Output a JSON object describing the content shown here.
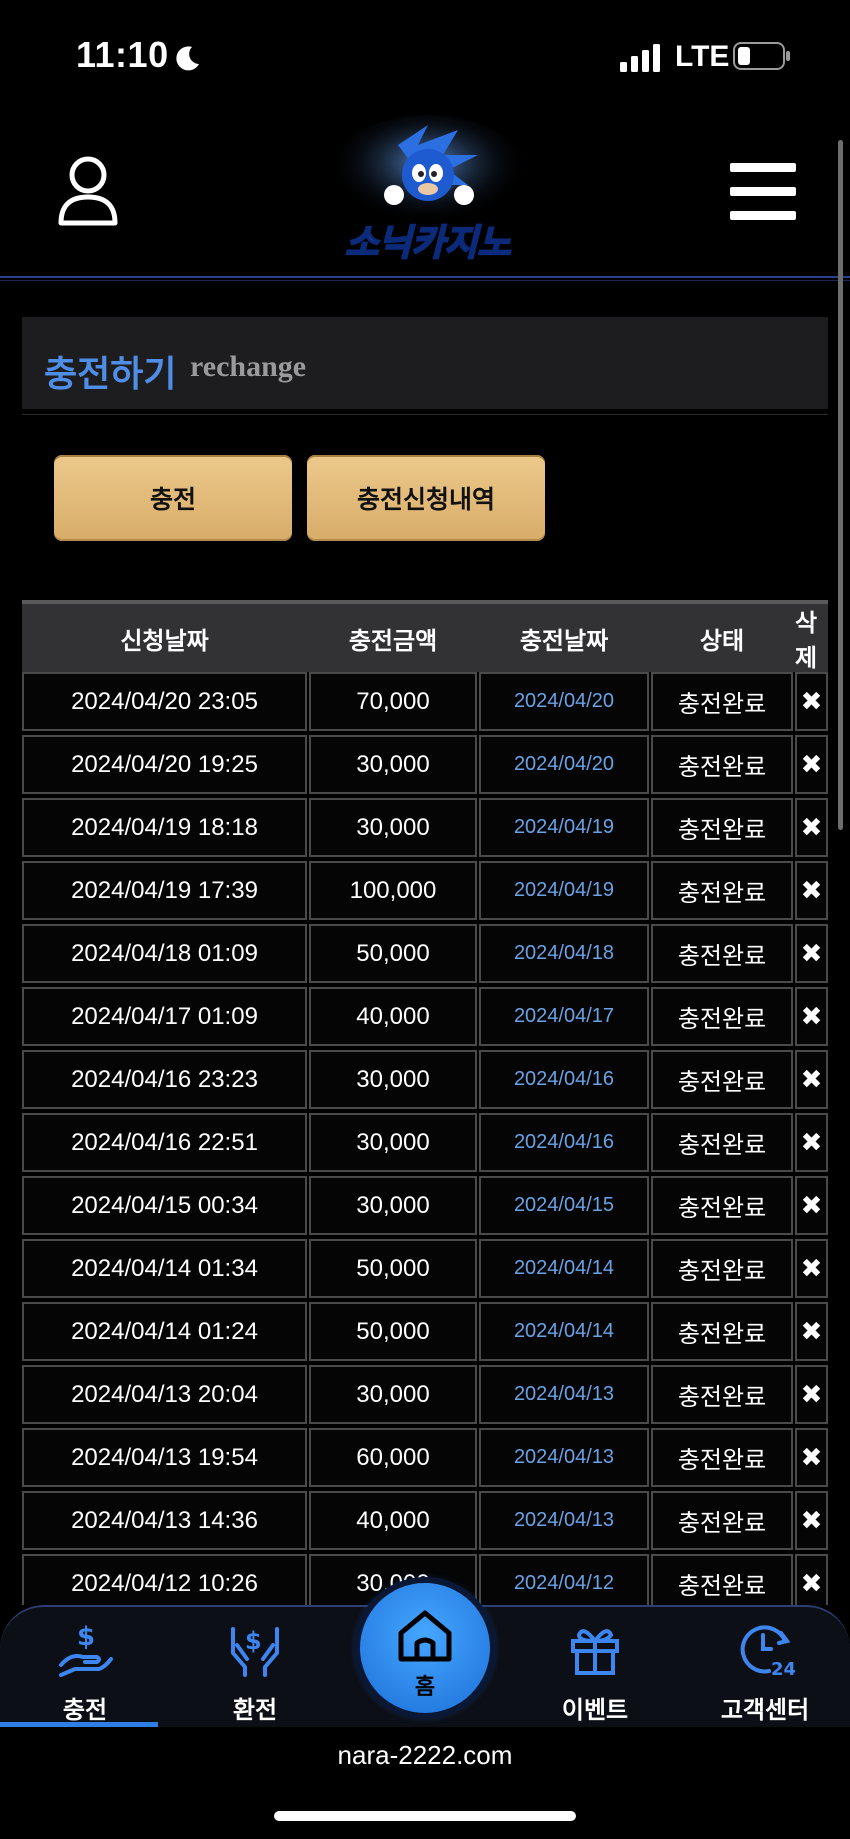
{
  "status_bar": {
    "time": "11:10",
    "network": "LTE"
  },
  "header": {
    "logo_text": "소닉카지노"
  },
  "page_title": {
    "korean": "충전하기",
    "english": "rechange"
  },
  "buttons": {
    "charge": "충전",
    "history": "충전신청내역"
  },
  "table": {
    "headers": [
      "신청날짜",
      "충전금액",
      "충전날짜",
      "상태",
      "삭제"
    ],
    "rows": [
      {
        "requested": "2024/04/20 23:05",
        "amount": "70,000",
        "charged": "2024/04/20",
        "status": "충전완료",
        "delete": "✖"
      },
      {
        "requested": "2024/04/20 19:25",
        "amount": "30,000",
        "charged": "2024/04/20",
        "status": "충전완료",
        "delete": "✖"
      },
      {
        "requested": "2024/04/19 18:18",
        "amount": "30,000",
        "charged": "2024/04/19",
        "status": "충전완료",
        "delete": "✖"
      },
      {
        "requested": "2024/04/19 17:39",
        "amount": "100,000",
        "charged": "2024/04/19",
        "status": "충전완료",
        "delete": "✖"
      },
      {
        "requested": "2024/04/18 01:09",
        "amount": "50,000",
        "charged": "2024/04/18",
        "status": "충전완료",
        "delete": "✖"
      },
      {
        "requested": "2024/04/17 01:09",
        "amount": "40,000",
        "charged": "2024/04/17",
        "status": "충전완료",
        "delete": "✖"
      },
      {
        "requested": "2024/04/16 23:23",
        "amount": "30,000",
        "charged": "2024/04/16",
        "status": "충전완료",
        "delete": "✖"
      },
      {
        "requested": "2024/04/16 22:51",
        "amount": "30,000",
        "charged": "2024/04/16",
        "status": "충전완료",
        "delete": "✖"
      },
      {
        "requested": "2024/04/15 00:34",
        "amount": "30,000",
        "charged": "2024/04/15",
        "status": "충전완료",
        "delete": "✖"
      },
      {
        "requested": "2024/04/14 01:34",
        "amount": "50,000",
        "charged": "2024/04/14",
        "status": "충전완료",
        "delete": "✖"
      },
      {
        "requested": "2024/04/14 01:24",
        "amount": "50,000",
        "charged": "2024/04/14",
        "status": "충전완료",
        "delete": "✖"
      },
      {
        "requested": "2024/04/13 20:04",
        "amount": "30,000",
        "charged": "2024/04/13",
        "status": "충전완료",
        "delete": "✖"
      },
      {
        "requested": "2024/04/13 19:54",
        "amount": "60,000",
        "charged": "2024/04/13",
        "status": "충전완료",
        "delete": "✖"
      },
      {
        "requested": "2024/04/13 14:36",
        "amount": "40,000",
        "charged": "2024/04/13",
        "status": "충전완료",
        "delete": "✖"
      },
      {
        "requested": "2024/04/12 10:26",
        "amount": "30,000",
        "charged": "2024/04/12",
        "status": "충전완료",
        "delete": "✖"
      }
    ]
  },
  "bottom_nav": {
    "items": [
      {
        "label": "충전",
        "icon": "charge-icon"
      },
      {
        "label": "환전",
        "icon": "exchange-icon"
      },
      {
        "label": "홈",
        "icon": "home-icon"
      },
      {
        "label": "이벤트",
        "icon": "gift-icon"
      },
      {
        "label": "고객센터",
        "icon": "support-24-icon"
      }
    ],
    "active": "충전"
  },
  "browser": {
    "url": "nara-2222.com"
  },
  "colors": {
    "accent_blue": "#4f8ee6",
    "button_gold": "#e3bd7c",
    "date_blue": "#6aa2e6"
  }
}
